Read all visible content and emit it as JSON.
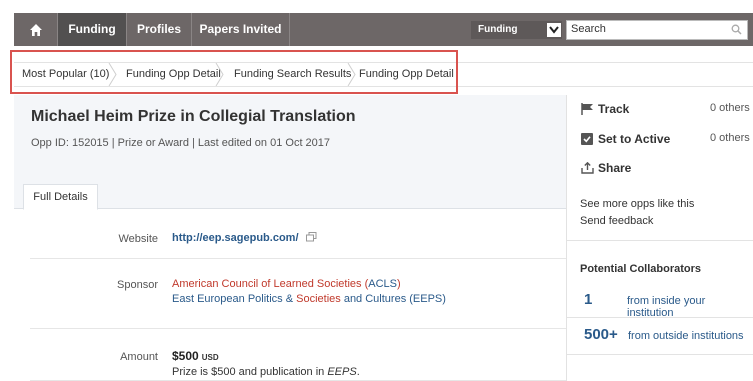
{
  "nav": {
    "tabs": [
      "Funding",
      "Profiles",
      "Papers Invited"
    ],
    "scope_value": "Funding",
    "search_placeholder": "Search"
  },
  "breadcrumb": [
    "Most Popular (10)",
    "Funding Opp Detail",
    "Funding Search Results",
    "Funding Opp Detail"
  ],
  "opportunity": {
    "title": "Michael Heim Prize in Collegial Translation",
    "meta": "Opp ID: 152015  |  Prize or Award  |  Last edited on 01 Oct 2017",
    "tab": "Full Details",
    "website_label": "Website",
    "website_url": "http://eep.sagepub.com/",
    "sponsor_label": "Sponsor",
    "sponsor_line1_a": "American Council of Learned Societies (",
    "sponsor_line1_abbr": "ACLS",
    "sponsor_line1_b": ")",
    "sponsor_line2_a": "East European Politics & ",
    "sponsor_line2_red": "Societies",
    "sponsor_line2_b": " and Cultures (EEPS)",
    "amount_label": "Amount",
    "amount_value": "$500",
    "amount_currency": "USD",
    "amount_note_a": "Prize is $500 and publication in ",
    "amount_note_em": "EEPS",
    "amount_note_b": "."
  },
  "sidebar": {
    "track_label": "Track",
    "track_count": "0 others",
    "active_label": "Set to Active",
    "active_count": "0 others",
    "share_label": "Share",
    "more_opps": "See more opps like this",
    "feedback": "Send feedback",
    "collab_title": "Potential Collaborators",
    "collab_inside_num": "1",
    "collab_inside_label": "from inside your institution",
    "collab_outside_num": "500+",
    "collab_outside_label": "from outside institutions"
  },
  "colors": {
    "nav_bg": "#6d6767",
    "nav_active": "#525050",
    "link_blue": "#2a5a8a",
    "link_red": "#c0392b",
    "highlight": "#d9534f"
  }
}
